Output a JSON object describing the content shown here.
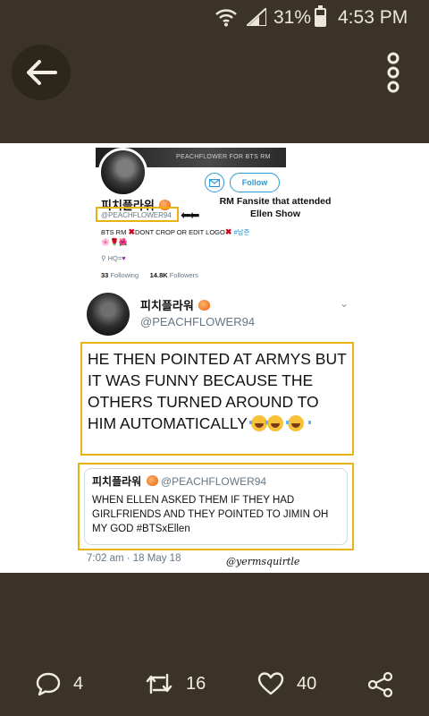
{
  "status_bar": {
    "battery": "31%",
    "time": "4:53 PM"
  },
  "header": {
    "back_icon": "arrow-left-icon",
    "menu_icon": "more-vertical-icon"
  },
  "profile": {
    "banner_text": "PEACHFLOWER FOR BTS RM",
    "name": "피치플라워",
    "handle": "@PEACHFLOWER94",
    "arrows": "⬅⬅",
    "follow_label": "Follow",
    "fansite_note": "RM Fansite that attended Ellen Show",
    "bio_prefix": "BTS RM",
    "bio_middle": "DONT CROP OR EDIT LOGO",
    "bio_tag": "#남준",
    "bio_emoji": "🌸🌹🌺",
    "hq_label": "HQ=",
    "following_count": "33",
    "following_label": "Following",
    "followers_count": "14.8K",
    "followers_label": "Followers"
  },
  "tweet": {
    "name": "피치플라워",
    "handle": "@PEACHFLOWER94",
    "text": "HE THEN POINTED AT ARMYS BUT IT WAS FUNNY BECAUSE THE OTHERS TURNED AROUND TO HIM AUTOMATICALLY",
    "quote_name": "피치플라워",
    "quote_handle": "@PEACHFLOWER94",
    "quote_text": "WHEN ELLEN ASKED THEM IF THEY HAD GIRLFRIENDS AND THEY POINTED TO JIMIN OH MY GOD #BTSxEllen",
    "timestamp": "7:02 am · 18 May 18",
    "watermark": "@yermsquirtle"
  },
  "actions": {
    "comments": "4",
    "reposts": "16",
    "likes": "40"
  },
  "colors": {
    "background": "#3b3426",
    "highlight_border": "#e8b20f",
    "twitter_blue": "#2b9bd8"
  }
}
